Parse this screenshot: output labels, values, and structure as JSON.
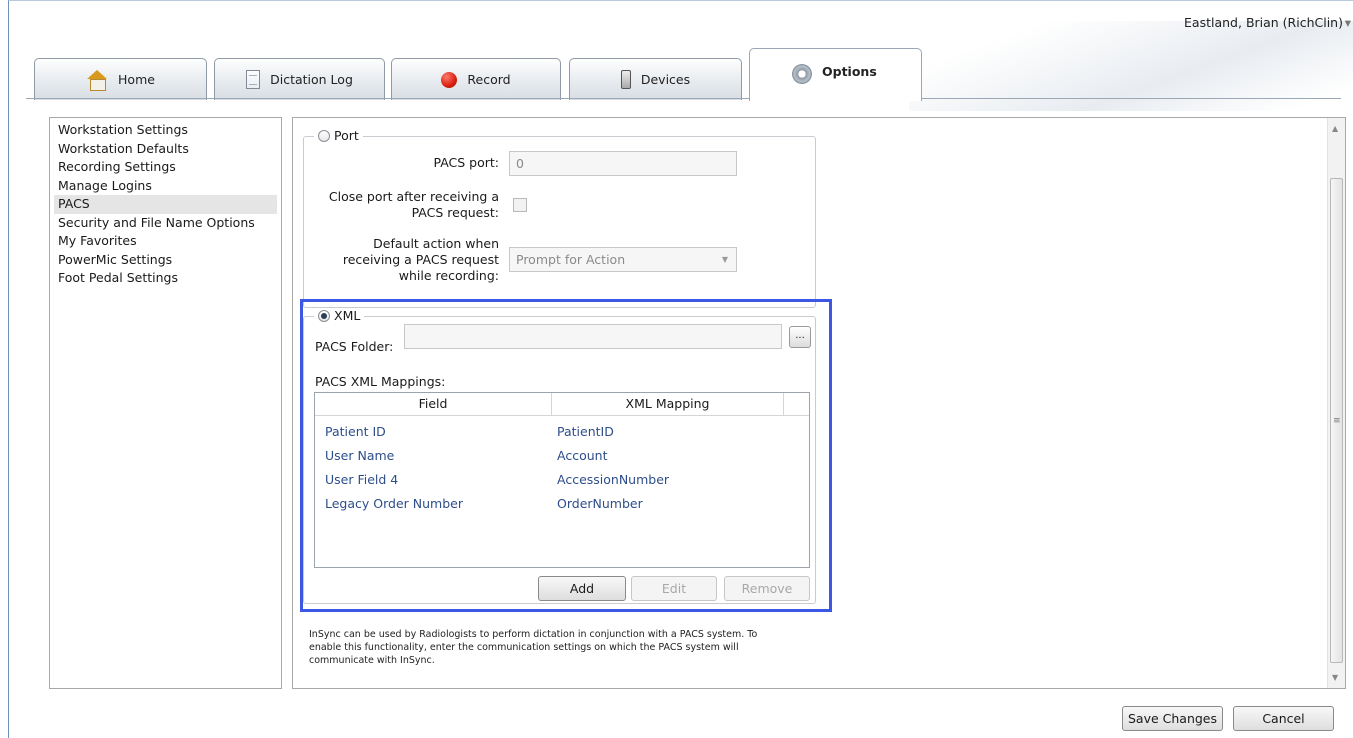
{
  "user": {
    "name": "Eastland, Brian (RichClin)"
  },
  "tabs": [
    {
      "label": "Home",
      "icon": "home-icon"
    },
    {
      "label": "Dictation Log",
      "icon": "document-icon"
    },
    {
      "label": "Record",
      "icon": "record-icon"
    },
    {
      "label": "Devices",
      "icon": "device-icon"
    },
    {
      "label": "Options",
      "icon": "gear-icon",
      "active": true
    }
  ],
  "sidebar": {
    "items": [
      {
        "label": "Workstation Settings"
      },
      {
        "label": "Workstation Defaults"
      },
      {
        "label": "Recording Settings"
      },
      {
        "label": "Manage Logins"
      },
      {
        "label": "PACS",
        "selected": true
      },
      {
        "label": "Security and File Name Options"
      },
      {
        "label": "My Favorites"
      },
      {
        "label": "PowerMic Settings"
      },
      {
        "label": "Foot Pedal Settings"
      }
    ]
  },
  "port": {
    "label": "Port",
    "selected": false,
    "pacs_port_label": "PACS port:",
    "pacs_port_value": "0",
    "close_port_label_1": "Close port after receiving a",
    "close_port_label_2": "PACS request:",
    "close_port_checked": false,
    "default_action_label_1": "Default action when",
    "default_action_label_2": "receiving a PACS request",
    "default_action_label_3": "while recording:",
    "default_action_value": "Prompt for Action"
  },
  "xml": {
    "label": "XML",
    "selected": true,
    "folder_label": "PACS Folder:",
    "folder_value": "",
    "browse_label": "...",
    "mappings_label": "PACS XML Mappings:",
    "columns": {
      "field": "Field",
      "mapping": "XML Mapping"
    },
    "rows": [
      {
        "field": "Patient ID",
        "mapping": "PatientID"
      },
      {
        "field": "User Name",
        "mapping": "Account"
      },
      {
        "field": "User Field 4",
        "mapping": "AccessionNumber"
      },
      {
        "field": "Legacy Order Number",
        "mapping": "OrderNumber"
      }
    ],
    "add_label": "Add",
    "edit_label": "Edit",
    "remove_label": "Remove"
  },
  "help_text_1": "InSync can be used by Radiologists to perform dictation in conjunction with a PACS system. To",
  "help_text_2": "enable this functionality, enter the communication settings on which the PACS system will",
  "help_text_3": "communicate with InSync.",
  "footer": {
    "save_label": "Save Changes",
    "cancel_label": "Cancel"
  },
  "colors": {
    "highlight": "#3b57e3",
    "link": "#2d4e8a",
    "record": "#d81f0e"
  }
}
